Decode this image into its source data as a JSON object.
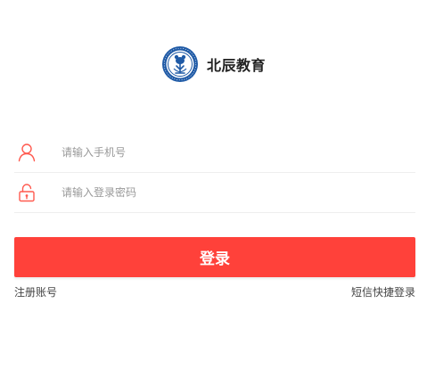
{
  "brand": {
    "name": "北辰教育"
  },
  "form": {
    "phone_placeholder": "请输入手机号",
    "password_placeholder": "请输入登录密码",
    "login_label": "登录"
  },
  "links": {
    "register": "注册账号",
    "sms_login": "短信快捷登录"
  },
  "icons": {
    "logo": "bear-emblem-logo",
    "phone_field": "user-icon",
    "password_field": "lock-icon"
  },
  "colors": {
    "accent": "#ff413a",
    "logo_blue": "#1f5aa6",
    "icon": "#ff5a4f"
  }
}
